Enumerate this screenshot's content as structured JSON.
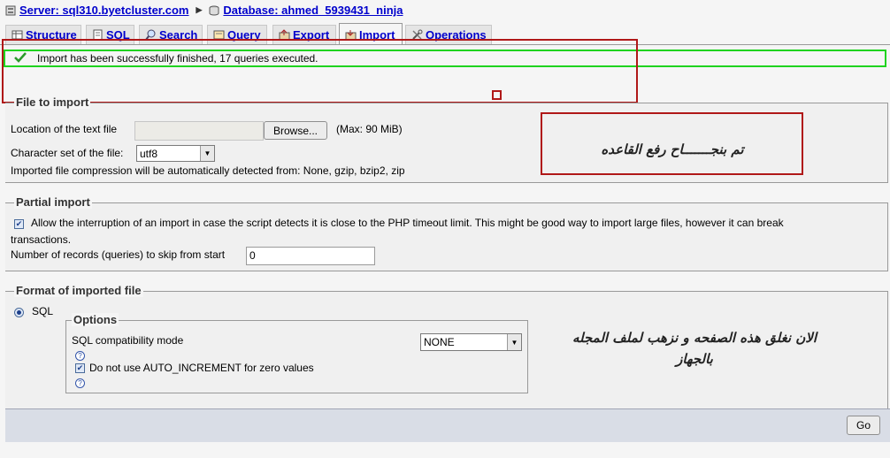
{
  "breadcrumb": {
    "server_label": "Server: sql310.byetcluster.com",
    "db_label": "Database: ahmed_5939431_ninja"
  },
  "tabs": [
    {
      "label": "Structure",
      "icon": "structure-icon"
    },
    {
      "label": "SQL",
      "icon": "sql-icon"
    },
    {
      "label": "Search",
      "icon": "search-icon"
    },
    {
      "label": "Query",
      "icon": "query-icon"
    },
    {
      "label": "Export",
      "icon": "export-icon"
    },
    {
      "label": "Import",
      "icon": "import-icon"
    },
    {
      "label": "Operations",
      "icon": "operations-icon"
    }
  ],
  "success_message": "Import has been successfully finished, 17 queries executed.",
  "file_to_import": {
    "legend": "File to import",
    "location_label": "Location of the text file",
    "browse_label": "Browse...",
    "max_label": "(Max: 90 MiB)",
    "charset_label": "Character set of the file:",
    "charset_value": "utf8",
    "compression_note": "Imported file compression will be automatically detected from: None, gzip, bzip2, zip"
  },
  "partial_import": {
    "legend": "Partial import",
    "interrupt_label": "Allow the interruption of an import in case the script detects it is close to the PHP timeout limit. This might be good way to import large files, however it can break",
    "interrupt_label_cont": "transactions.",
    "interrupt_checked": true,
    "skip_label": "Number of records (queries) to skip from start",
    "skip_value": "0"
  },
  "format": {
    "legend": "Format of imported file",
    "sql_label": "SQL",
    "options_legend": "Options",
    "compat_label": "SQL compatibility mode",
    "compat_value": "NONE",
    "auto_inc_label": "Do not use AUTO_INCREMENT for zero values",
    "auto_inc_checked": true
  },
  "go_label": "Go",
  "annotations": {
    "note1": "تم بنجـــــــاح رفع القاعده",
    "note2_line1": "الان نغلق هذه الصفحه و نزهب لملف المجله",
    "note2_line2": "بالجهاز"
  },
  "colors": {
    "success_border": "#1fd31f",
    "annotation_red": "#b01818",
    "link_blue": "#0000cc"
  }
}
